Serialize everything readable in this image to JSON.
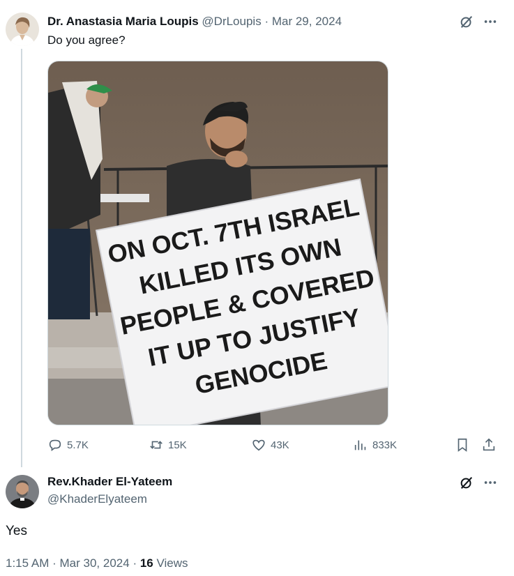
{
  "original_tweet": {
    "author_name": "Dr. Anastasia Maria Loupis",
    "author_handle": "@DrLoupis",
    "separator": "·",
    "date": "Mar 29, 2024",
    "text": "Do you agree?",
    "image_sign_lines": [
      "ON OCT. 7TH ISRAEL",
      "KILLED ITS OWN",
      "PEOPLE & COVERED",
      "IT UP TO JUSTIFY",
      "GENOCIDE"
    ],
    "actions": {
      "replies": "5.7K",
      "reposts": "15K",
      "likes": "43K",
      "views": "833K"
    },
    "icons": [
      "grok-icon",
      "more-icon",
      "reply-icon",
      "repost-icon",
      "like-icon",
      "views-icon",
      "bookmark-icon",
      "share-icon"
    ]
  },
  "reply_tweet": {
    "author_name": "Rev.Khader El-Yateem",
    "author_handle": "@KhaderElyateem",
    "text": "Yes",
    "time": "1:15 AM",
    "separator": "·",
    "date": "Mar 30, 2024",
    "views_count": "16",
    "views_label": "Views"
  },
  "colors": {
    "text": "#0f1419",
    "secondary": "#536471",
    "thread_line": "#cfd9de"
  }
}
